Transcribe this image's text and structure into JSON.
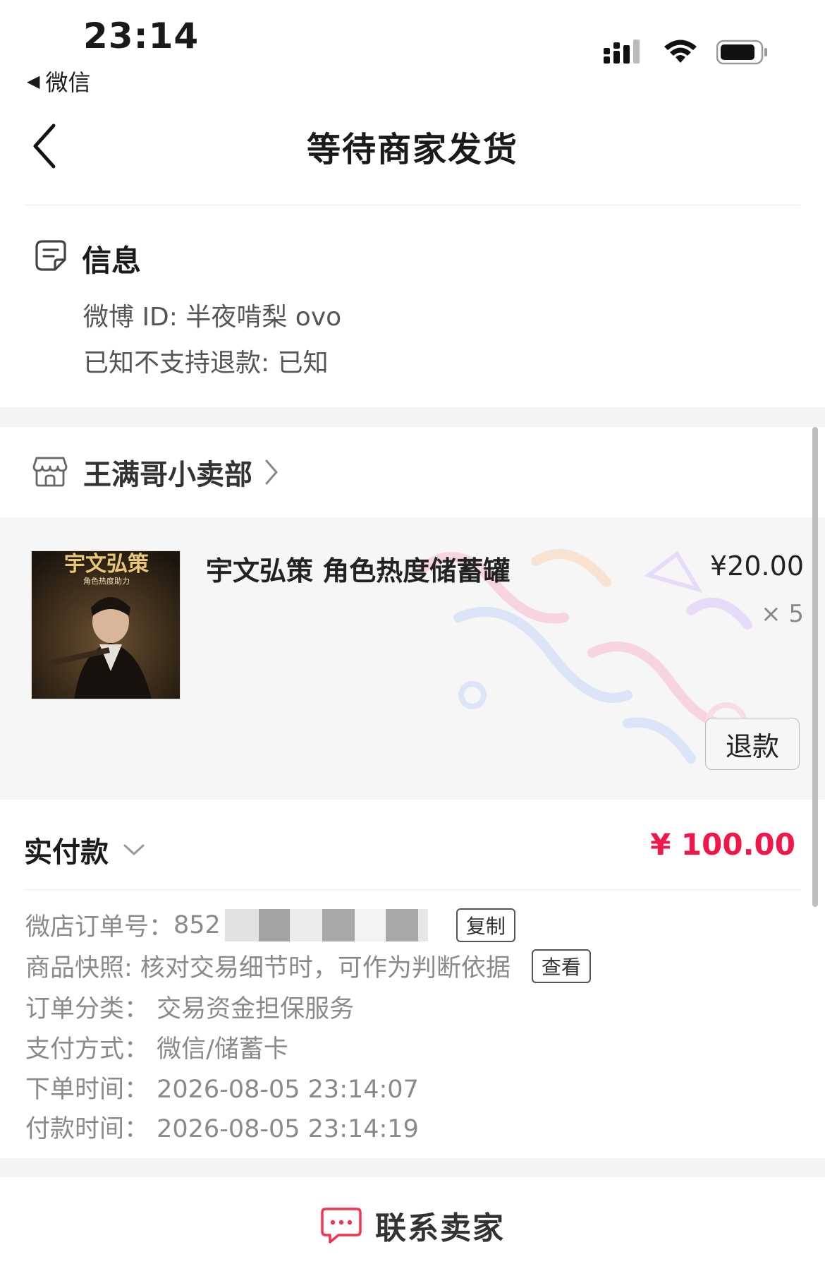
{
  "status_bar": {
    "time": "23:14",
    "back_app": "微信",
    "icons": [
      "signal-icon",
      "wifi-icon",
      "battery-icon"
    ]
  },
  "nav": {
    "title": "等待商家发货"
  },
  "info": {
    "title": "信息",
    "lines": [
      "微博 ID: 半夜啃梨 ovo",
      "已知不支持退款: 已知"
    ]
  },
  "store": {
    "name": "王满哥小卖部"
  },
  "product": {
    "name": "宇文弘策 角色热度储蓄罐",
    "price": "¥20.00",
    "quantity": "× 5",
    "image_title": "宇文弘策",
    "image_subtitle": "角色热度助力",
    "refund_label": "退款"
  },
  "payment": {
    "label": "实付款",
    "amount": "¥ 100.00"
  },
  "details": {
    "order_no_label": "微店订单号：",
    "order_no_value": "852",
    "copy_label": "复制",
    "snapshot_text": "商品快照: 核对交易细节时，可作为判断依据",
    "view_label": "查看",
    "category": "订单分类：  交易资金担保服务",
    "pay_method": "支付方式：  微信/储蓄卡",
    "order_time": "下单时间：  2026-08-05 23:14:07",
    "pay_time": "付款时间：  2026-08-05 23:14:19"
  },
  "bottom": {
    "contact_label": "联系卖家"
  },
  "colors": {
    "accent": "#f0174a",
    "chat_icon": "#f2364f"
  }
}
